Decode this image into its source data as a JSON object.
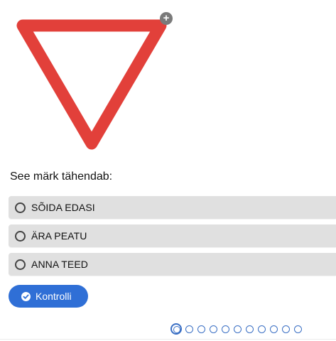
{
  "sign": {
    "icon": "yield-sign",
    "stroke_color": "#e2403a",
    "fill_color": "#ffffff"
  },
  "zoom": {
    "icon": "plus-circle-icon",
    "glyph": "+"
  },
  "question": {
    "text": "See märk tähendab:"
  },
  "options": [
    {
      "label": "SÕIDA EDASI"
    },
    {
      "label": "ÄRA PEATU"
    },
    {
      "label": "ANNA TEED"
    }
  ],
  "check_button": {
    "label": "Kontrolli",
    "icon": "check-circle-icon",
    "color": "#2f6fd6"
  },
  "pager": {
    "total": 11,
    "current": 1,
    "color": "#3a6fc4"
  }
}
